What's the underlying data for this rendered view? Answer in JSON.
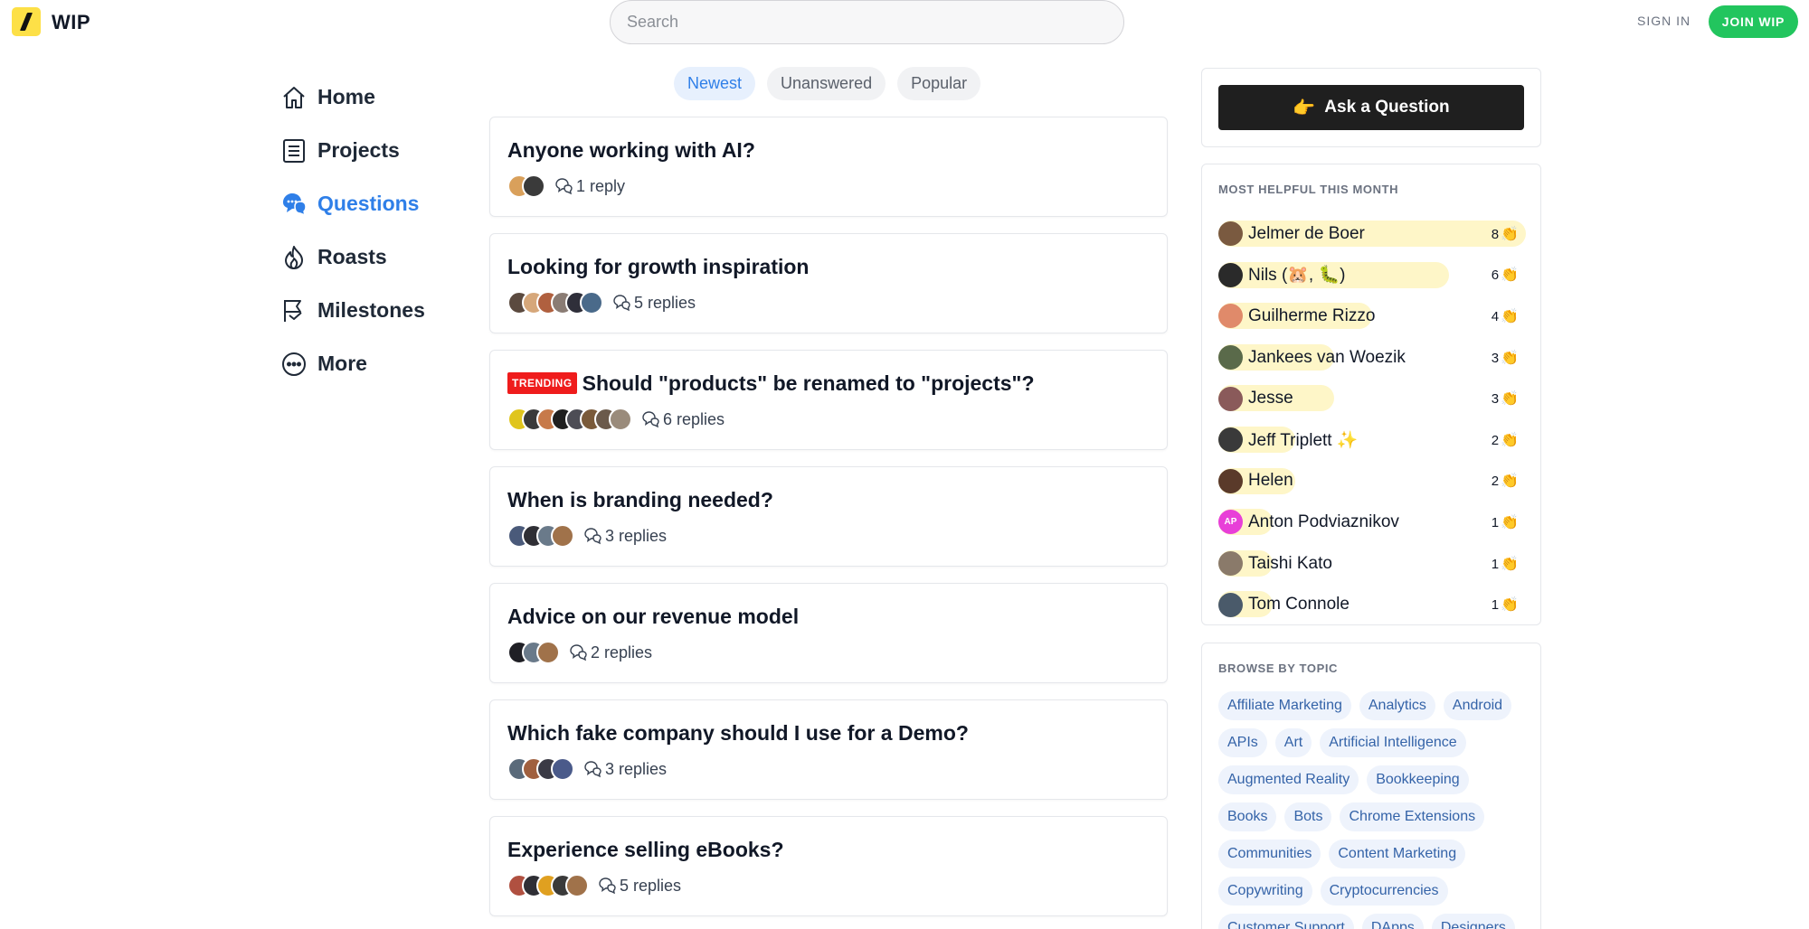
{
  "header": {
    "brand": "WIP",
    "search_placeholder": "Search",
    "sign_in": "SIGN IN",
    "join": "JOIN WIP"
  },
  "nav": {
    "items": [
      {
        "label": "Home",
        "icon": "home-icon"
      },
      {
        "label": "Projects",
        "icon": "projects-icon"
      },
      {
        "label": "Questions",
        "icon": "questions-icon",
        "active": true
      },
      {
        "label": "Roasts",
        "icon": "flame-icon"
      },
      {
        "label": "Milestones",
        "icon": "flag-icon"
      },
      {
        "label": "More",
        "icon": "more-icon"
      }
    ]
  },
  "tabs": [
    {
      "label": "Newest",
      "active": true
    },
    {
      "label": "Unanswered"
    },
    {
      "label": "Popular"
    }
  ],
  "questions": [
    {
      "title": "Anyone working with AI?",
      "replies": "1 reply",
      "trending": false,
      "avatar_colors": [
        "#d9a05b",
        "#3a3a3a"
      ]
    },
    {
      "title": "Looking for growth inspiration",
      "replies": "5 replies",
      "trending": false,
      "avatar_colors": [
        "#5b4a3f",
        "#d6a77a",
        "#b0603f",
        "#8a7c74",
        "#2f2f3a",
        "#4a6a8a"
      ]
    },
    {
      "title": "Should \"products\" be renamed to \"projects\"?",
      "replies": "6 replies",
      "trending": true,
      "trending_label": "TRENDING",
      "avatar_colors": [
        "#e0c51d",
        "#3a3a3a",
        "#c77a4a",
        "#1f1f1f",
        "#4d4d55",
        "#7a5a3a",
        "#6b5a4b",
        "#9a8b7b"
      ]
    },
    {
      "title": "When is branding needed?",
      "replies": "3 replies",
      "trending": false,
      "avatar_colors": [
        "#4a5a7a",
        "#2f2f35",
        "#6a7a8a",
        "#a0724a"
      ]
    },
    {
      "title": "Advice on our revenue model",
      "replies": "2 replies",
      "trending": false,
      "avatar_colors": [
        "#1f1f25",
        "#6a7a8a",
        "#a0724a"
      ]
    },
    {
      "title": "Which fake company should I use for a Demo?",
      "replies": "3 replies",
      "trending": false,
      "avatar_colors": [
        "#5a6a7a",
        "#a0603f",
        "#3a3a45",
        "#4a5a8a"
      ]
    },
    {
      "title": "Experience selling eBooks?",
      "replies": "5 replies",
      "trending": false,
      "avatar_colors": [
        "#b05040",
        "#2f2f35",
        "#e0a020",
        "#3a3a3a",
        "#a0724a"
      ]
    }
  ],
  "ask": {
    "emoji": "👉",
    "label": "Ask a Question"
  },
  "helpful": {
    "heading": "MOST HELPFUL THIS MONTH",
    "clap": "👏",
    "people": [
      {
        "name": "Jelmer de Boer",
        "count": "8",
        "bar": 1.0,
        "color": "#7a5a40",
        "initials": ""
      },
      {
        "name": "Nils (🐹, 🐛)",
        "count": "6",
        "bar": 0.75,
        "color": "#2a2a2a",
        "initials": ""
      },
      {
        "name": "Guilherme Rizzo",
        "count": "4",
        "bar": 0.5,
        "color": "#e08a6a",
        "initials": ""
      },
      {
        "name": "Jankees van Woezik",
        "count": "3",
        "bar": 0.375,
        "color": "#5a6a4a",
        "initials": ""
      },
      {
        "name": "Jesse",
        "count": "3",
        "bar": 0.375,
        "color": "#8a5a5a",
        "initials": ""
      },
      {
        "name": "Jeff Triplett ✨",
        "count": "2",
        "bar": 0.25,
        "color": "#3a3a3a",
        "initials": ""
      },
      {
        "name": "Helen",
        "count": "2",
        "bar": 0.25,
        "color": "#5a3a2a",
        "initials": ""
      },
      {
        "name": "Anton Podviaznikov",
        "count": "1",
        "bar": 0.125,
        "color": "#e83fd8",
        "initials": "AP"
      },
      {
        "name": "Taishi Kato",
        "count": "1",
        "bar": 0.125,
        "color": "#8a7a6a",
        "initials": ""
      },
      {
        "name": "Tom Connole",
        "count": "1",
        "bar": 0.125,
        "color": "#4a5a6a",
        "initials": ""
      }
    ]
  },
  "topics": {
    "heading": "BROWSE BY TOPIC",
    "items": [
      "Affiliate Marketing",
      "Analytics",
      "Android",
      "APIs",
      "Art",
      "Artificial Intelligence",
      "Augmented Reality",
      "Bookkeeping",
      "Books",
      "Bots",
      "Chrome Extensions",
      "Communities",
      "Content Marketing",
      "Copywriting",
      "Cryptocurrencies",
      "Customer Support",
      "DApps",
      "Designers"
    ]
  }
}
